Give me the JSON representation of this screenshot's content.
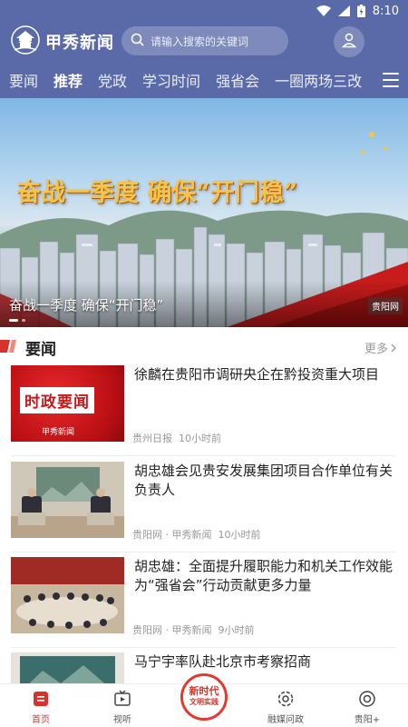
{
  "status_bar": {
    "time": "8:10"
  },
  "header": {
    "app_name": "甲秀新闻",
    "search_placeholder": "请输入搜索的关键词"
  },
  "tabs": [
    {
      "label": "要闻",
      "active": false
    },
    {
      "label": "推荐",
      "active": true
    },
    {
      "label": "党政",
      "active": false
    },
    {
      "label": "学习时间",
      "active": false
    },
    {
      "label": "强省会",
      "active": false
    },
    {
      "label": "一圈两场三改",
      "active": false
    }
  ],
  "banner": {
    "headline": "奋战一季度 确保“开门稳”",
    "caption": "奋战一季度  确保“开门稳”",
    "corner_logo": "贵阳网",
    "slide_index": 1,
    "slide_count": 2
  },
  "section": {
    "title": "要闻",
    "more_label": "更多"
  },
  "news": [
    {
      "title": "徐麟在贵阳市调研央企在黔投资重大项目",
      "source": "贵州日报",
      "time": "10小时前",
      "thumb_text": "时政要闻",
      "thumb_logo": "甲秀新闻"
    },
    {
      "title": "胡忠雄会见贵安发展集团项目合作单位有关负责人",
      "source": "贵阳网 · 甲秀新闻",
      "time": "10小时前"
    },
    {
      "title": "胡忠雄：全面提升履职能力和机关工作效能 为“强省会”行动贡献更多力量",
      "source": "贵阳网 · 甲秀新闻",
      "time": "9小时前"
    },
    {
      "title": "马宁宇率队赴北京市考察招商",
      "source": "",
      "time": ""
    }
  ],
  "bottom_nav": [
    {
      "label": "首页",
      "icon": "home-icon",
      "active": true
    },
    {
      "label": "视听",
      "icon": "tv-icon",
      "active": false
    },
    {
      "label": "新时代文明实践",
      "icon": "badge",
      "active": false
    },
    {
      "label": "融媒问政",
      "icon": "gear-icon",
      "active": false
    },
    {
      "label": "贵阳+",
      "icon": "target-icon",
      "active": false
    }
  ],
  "center_badge": {
    "line1": "新时代",
    "line2": "文明实践"
  },
  "colors": {
    "brand": "#5a6aa8",
    "accent_red": "#d9322b",
    "banner_gold": "#f6c447"
  }
}
